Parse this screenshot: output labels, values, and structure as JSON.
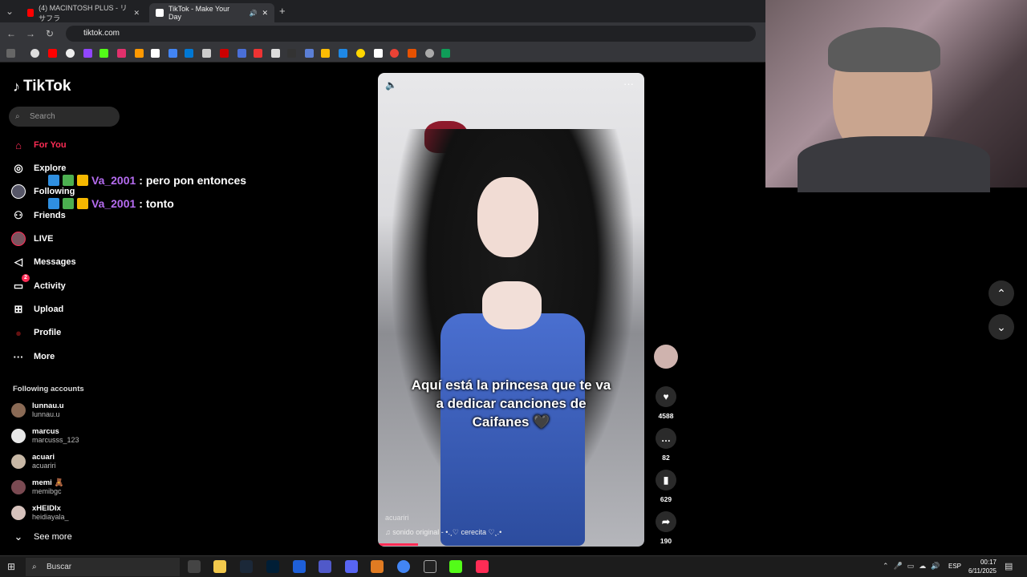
{
  "browser": {
    "tabs": [
      {
        "title": "(4) MACINTOSH PLUS - リサフラ",
        "color": "#ff0000"
      },
      {
        "title": "TikTok - Make Your Day",
        "color": "#ffffff"
      }
    ],
    "url": "tiktok.com",
    "new_tab_symbol": "+",
    "close_symbol": "✕"
  },
  "sidebar": {
    "logo": "TikTok",
    "search_placeholder": "Search",
    "nav": [
      {
        "label": "For You",
        "icon": "home-icon",
        "active": true
      },
      {
        "label": "Explore",
        "icon": "compass-icon"
      },
      {
        "label": "Following",
        "icon": "following-avatar-icon"
      },
      {
        "label": "Friends",
        "icon": "friends-icon"
      },
      {
        "label": "LIVE",
        "icon": "live-icon"
      },
      {
        "label": "Messages",
        "icon": "messages-icon"
      },
      {
        "label": "Activity",
        "icon": "activity-icon",
        "badge": "2"
      },
      {
        "label": "Upload",
        "icon": "upload-icon"
      },
      {
        "label": "Profile",
        "icon": "profile-icon"
      },
      {
        "label": "More",
        "icon": "more-icon"
      }
    ],
    "following_header": "Following accounts",
    "accounts": [
      {
        "name": "lunnau.u",
        "handle": "lunnau.u",
        "color": "#8a6a55"
      },
      {
        "name": "marcus",
        "handle": "marcusss_123",
        "color": "#e8e8e8"
      },
      {
        "name": "acuari",
        "handle": "acuariri",
        "color": "#c8b8a6"
      },
      {
        "name": "memi 🧸",
        "handle": "memibgc",
        "color": "#7a4a52"
      },
      {
        "name": "xHEIDIx",
        "handle": "heidiayala_",
        "color": "#d6c2bc"
      }
    ],
    "see_more": "See more"
  },
  "chat_overlay": [
    {
      "user": "Va_2001",
      "message": ": pero pon entonces"
    },
    {
      "user": "Va_2001",
      "message": ": tonto"
    }
  ],
  "video": {
    "caption": "Aquí está la princesa que te va a dedicar canciones de Caifanes 🖤",
    "author": "acuariri",
    "sound": "♫ sonido original - •.¸♡ cerecita ♡¸.•",
    "volume_icon": "volume-icon",
    "more_icon": "ellipsis-icon"
  },
  "actions": {
    "likes": "4588",
    "comments": "82",
    "saves": "629",
    "shares": "190"
  },
  "taskbar": {
    "search": "Buscar",
    "language": "ESP",
    "time": "00:17",
    "date": "6/11/2025"
  }
}
